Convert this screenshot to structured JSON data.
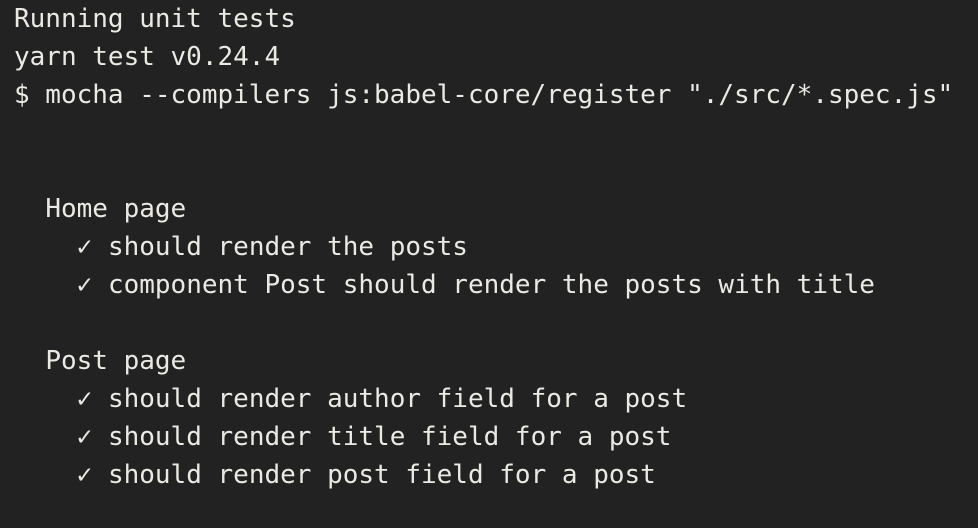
{
  "terminal": {
    "background_color": "#222222",
    "text_color": "#ebe9e3",
    "check_glyph": "✓",
    "header_lines": [
      "Running unit tests",
      "yarn test v0.24.4",
      "$ mocha --compilers js:babel-core/register \"./src/*.spec.js\""
    ],
    "suites": [
      {
        "name": "Home page",
        "indent": "  ",
        "tests": [
          {
            "indent": "    ",
            "status": "✓",
            "title": "should render the posts"
          },
          {
            "indent": "    ",
            "status": "✓",
            "title": "component Post should render the posts with title"
          }
        ]
      },
      {
        "name": "Post page",
        "indent": "  ",
        "tests": [
          {
            "indent": "    ",
            "status": "✓",
            "title": "should render author field for a post"
          },
          {
            "indent": "    ",
            "status": "✓",
            "title": "should render title field for a post"
          },
          {
            "indent": "    ",
            "status": "✓",
            "title": "should render post field for a post"
          }
        ]
      }
    ]
  }
}
